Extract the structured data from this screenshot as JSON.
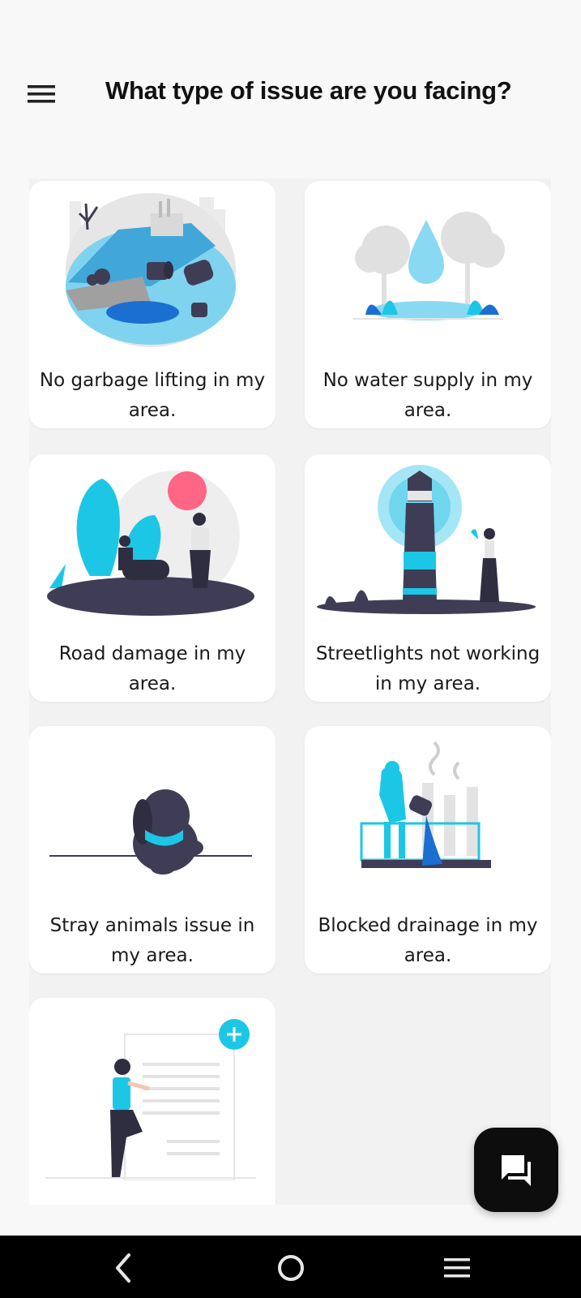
{
  "header": {
    "title": "What type of issue are you facing?",
    "menu_icon": "hamburger-menu-icon"
  },
  "issues": [
    {
      "label": "No garbage lifting in my area.",
      "illustration": "garbage-pollution-illustration"
    },
    {
      "label": "No water supply in my area.",
      "illustration": "water-drop-illustration"
    },
    {
      "label": "Road damage in my area.",
      "illustration": "people-park-illustration"
    },
    {
      "label": "Streetlights not working in my area.",
      "illustration": "lighthouse-illustration"
    },
    {
      "label": "Stray animals issue in my area.",
      "illustration": "dog-illustration"
    },
    {
      "label": "Blocked drainage in my area.",
      "illustration": "drainage-worker-illustration"
    },
    {
      "label": "",
      "illustration": "add-document-illustration"
    }
  ],
  "fab": {
    "icon": "chat-icon"
  },
  "system_nav": {
    "back_icon": "back-icon",
    "home_icon": "home-icon",
    "recents_icon": "recents-icon"
  },
  "colors": {
    "accent": "#1cc7e6",
    "dark": "#3f3d56",
    "pink": "#ff6584",
    "background": "#f8f8f8"
  }
}
